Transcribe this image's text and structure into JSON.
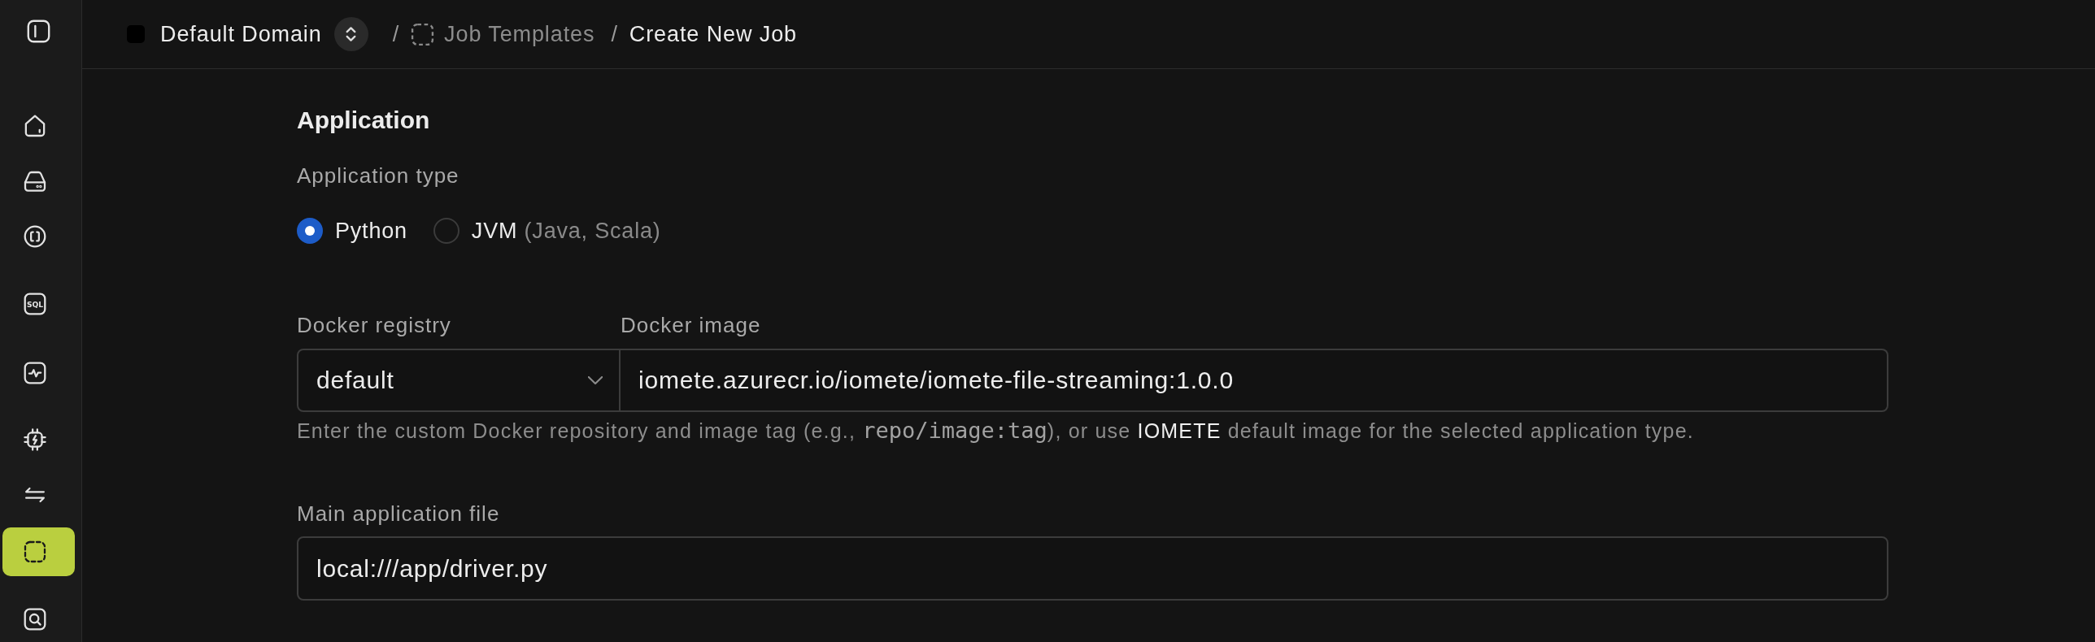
{
  "sidebar": {
    "items": [
      {
        "selected": false
      },
      {
        "selected": false
      },
      {
        "selected": false
      },
      {
        "selected": false,
        "icon_text": "SQL"
      },
      {
        "selected": false
      },
      {
        "selected": false
      },
      {
        "selected": false
      },
      {
        "selected": true
      },
      {
        "selected": false
      }
    ]
  },
  "topbar": {
    "domain": {
      "label": "Default Domain"
    },
    "breadcrumbs": [
      {
        "separator": "/",
        "icon": true,
        "label": "Job Templates",
        "current": false
      },
      {
        "separator": "/",
        "icon": false,
        "label": "Create New Job",
        "current": true
      }
    ]
  },
  "application": {
    "title": "Application",
    "application_type": {
      "label": "Application type",
      "options": [
        {
          "label": "Python",
          "selected": true
        },
        {
          "label": "JVM",
          "note": "(Java, Scala)",
          "selected": false
        }
      ]
    },
    "docker_registry": {
      "label": "Docker registry",
      "value": "default"
    },
    "docker_image": {
      "label": "Docker image",
      "value": "iomete.azurecr.io/iomete/iomete-file-streaming:1.0.0"
    },
    "docker_help": [
      {
        "kind": "text",
        "text": "Enter the custom Docker repository and image tag (e.g., "
      },
      {
        "kind": "code",
        "text": "repo/image:tag"
      },
      {
        "kind": "text",
        "text": "), or use "
      },
      {
        "kind": "emphasis",
        "text": "IOMETE"
      },
      {
        "kind": "text",
        "text": " default image for the selected application type."
      }
    ],
    "main_application_file": {
      "label": "Main application file",
      "value": "local:///app/driver.py"
    }
  }
}
